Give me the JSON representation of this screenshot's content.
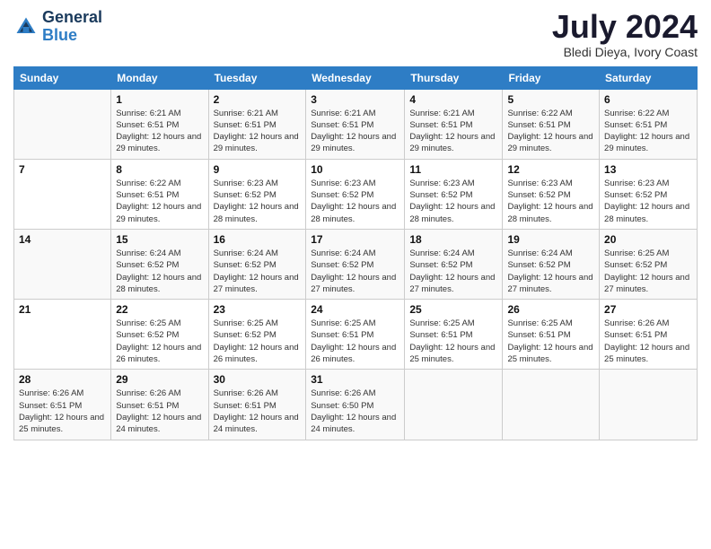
{
  "logo": {
    "general": "General",
    "blue": "Blue"
  },
  "title": "July 2024",
  "location": "Bledi Dieya, Ivory Coast",
  "days_header": [
    "Sunday",
    "Monday",
    "Tuesday",
    "Wednesday",
    "Thursday",
    "Friday",
    "Saturday"
  ],
  "weeks": [
    [
      {
        "day": "",
        "info": ""
      },
      {
        "day": "1",
        "info": "Sunrise: 6:21 AM\nSunset: 6:51 PM\nDaylight: 12 hours\nand 29 minutes."
      },
      {
        "day": "2",
        "info": "Sunrise: 6:21 AM\nSunset: 6:51 PM\nDaylight: 12 hours\nand 29 minutes."
      },
      {
        "day": "3",
        "info": "Sunrise: 6:21 AM\nSunset: 6:51 PM\nDaylight: 12 hours\nand 29 minutes."
      },
      {
        "day": "4",
        "info": "Sunrise: 6:21 AM\nSunset: 6:51 PM\nDaylight: 12 hours\nand 29 minutes."
      },
      {
        "day": "5",
        "info": "Sunrise: 6:22 AM\nSunset: 6:51 PM\nDaylight: 12 hours\nand 29 minutes."
      },
      {
        "day": "6",
        "info": "Sunrise: 6:22 AM\nSunset: 6:51 PM\nDaylight: 12 hours\nand 29 minutes."
      }
    ],
    [
      {
        "day": "7",
        "info": ""
      },
      {
        "day": "8",
        "info": "Sunrise: 6:22 AM\nSunset: 6:51 PM\nDaylight: 12 hours\nand 29 minutes."
      },
      {
        "day": "9",
        "info": "Sunrise: 6:23 AM\nSunset: 6:52 PM\nDaylight: 12 hours\nand 28 minutes."
      },
      {
        "day": "10",
        "info": "Sunrise: 6:23 AM\nSunset: 6:52 PM\nDaylight: 12 hours\nand 28 minutes."
      },
      {
        "day": "11",
        "info": "Sunrise: 6:23 AM\nSunset: 6:52 PM\nDaylight: 12 hours\nand 28 minutes."
      },
      {
        "day": "12",
        "info": "Sunrise: 6:23 AM\nSunset: 6:52 PM\nDaylight: 12 hours\nand 28 minutes."
      },
      {
        "day": "13",
        "info": "Sunrise: 6:23 AM\nSunset: 6:52 PM\nDaylight: 12 hours\nand 28 minutes."
      }
    ],
    [
      {
        "day": "14",
        "info": ""
      },
      {
        "day": "15",
        "info": "Sunrise: 6:24 AM\nSunset: 6:52 PM\nDaylight: 12 hours\nand 28 minutes."
      },
      {
        "day": "16",
        "info": "Sunrise: 6:24 AM\nSunset: 6:52 PM\nDaylight: 12 hours\nand 27 minutes."
      },
      {
        "day": "17",
        "info": "Sunrise: 6:24 AM\nSunset: 6:52 PM\nDaylight: 12 hours\nand 27 minutes."
      },
      {
        "day": "18",
        "info": "Sunrise: 6:24 AM\nSunset: 6:52 PM\nDaylight: 12 hours\nand 27 minutes."
      },
      {
        "day": "19",
        "info": "Sunrise: 6:24 AM\nSunset: 6:52 PM\nDaylight: 12 hours\nand 27 minutes."
      },
      {
        "day": "20",
        "info": "Sunrise: 6:25 AM\nSunset: 6:52 PM\nDaylight: 12 hours\nand 27 minutes."
      }
    ],
    [
      {
        "day": "21",
        "info": ""
      },
      {
        "day": "22",
        "info": "Sunrise: 6:25 AM\nSunset: 6:52 PM\nDaylight: 12 hours\nand 26 minutes."
      },
      {
        "day": "23",
        "info": "Sunrise: 6:25 AM\nSunset: 6:52 PM\nDaylight: 12 hours\nand 26 minutes."
      },
      {
        "day": "24",
        "info": "Sunrise: 6:25 AM\nSunset: 6:51 PM\nDaylight: 12 hours\nand 26 minutes."
      },
      {
        "day": "25",
        "info": "Sunrise: 6:25 AM\nSunset: 6:51 PM\nDaylight: 12 hours\nand 25 minutes."
      },
      {
        "day": "26",
        "info": "Sunrise: 6:25 AM\nSunset: 6:51 PM\nDaylight: 12 hours\nand 25 minutes."
      },
      {
        "day": "27",
        "info": "Sunrise: 6:26 AM\nSunset: 6:51 PM\nDaylight: 12 hours\nand 25 minutes."
      }
    ],
    [
      {
        "day": "28",
        "info": "Sunrise: 6:26 AM\nSunset: 6:51 PM\nDaylight: 12 hours\nand 25 minutes."
      },
      {
        "day": "29",
        "info": "Sunrise: 6:26 AM\nSunset: 6:51 PM\nDaylight: 12 hours\nand 24 minutes."
      },
      {
        "day": "30",
        "info": "Sunrise: 6:26 AM\nSunset: 6:51 PM\nDaylight: 12 hours\nand 24 minutes."
      },
      {
        "day": "31",
        "info": "Sunrise: 6:26 AM\nSunset: 6:50 PM\nDaylight: 12 hours\nand 24 minutes."
      },
      {
        "day": "",
        "info": ""
      },
      {
        "day": "",
        "info": ""
      },
      {
        "day": "",
        "info": ""
      }
    ]
  ],
  "week1_sun_info": "Sunrise: 6:22 AM\nSunset: 6:51 PM\nDaylight: 12 hours\nand 29 minutes.",
  "week2_sun_info": "",
  "week3_sun_info": "Sunrise: 6:24 AM\nSunset: 6:52 PM\nDaylight: 12 hours\nand 28 minutes.",
  "week4_sun_info": "Sunrise: 6:25 AM\nSunset: 6:52 PM\nDaylight: 12 hours\nand 26 minutes."
}
